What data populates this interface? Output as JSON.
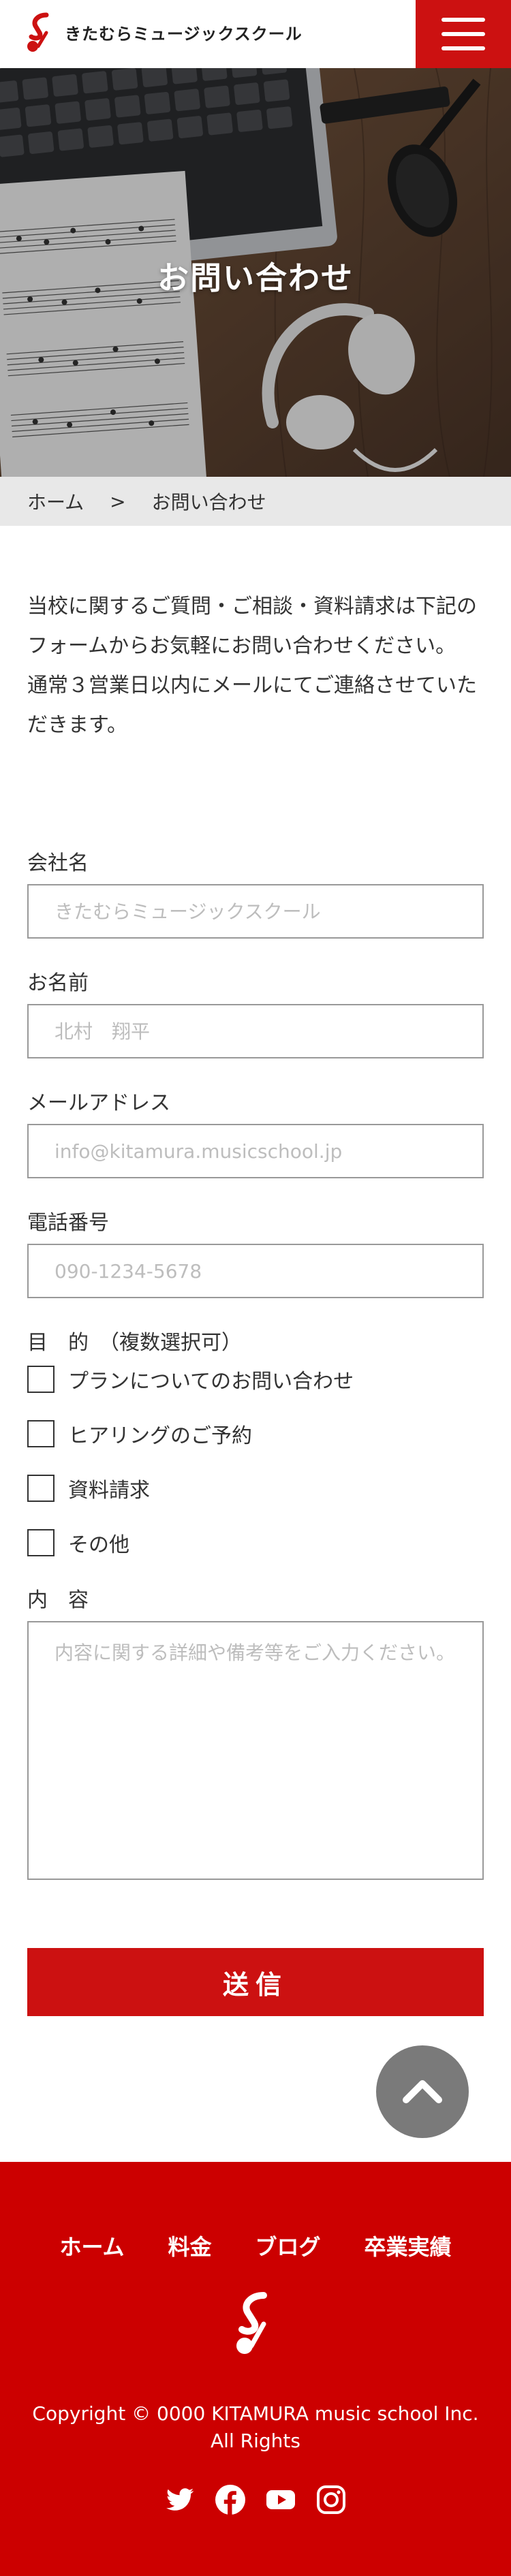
{
  "header": {
    "logo_text": "きたむらミュージックスクール",
    "menu_icon": "hamburger-menu-icon"
  },
  "hero": {
    "title": "お問い合わせ"
  },
  "breadcrumb": {
    "home": "ホーム",
    "separator": ">",
    "current": "お問い合わせ"
  },
  "intro": {
    "line1": "当校に関するご質問・ご相談・資料請求は下記のフォームからお気軽にお問い合わせください。",
    "line2": "通常３営業日以内にメールにてご連絡させていただきます。"
  },
  "form": {
    "company_label": "会社名",
    "company_placeholder": "きたむらミュージックスクール",
    "name_label": "お名前",
    "name_placeholder": "北村　翔平",
    "email_label": "メールアドレス",
    "email_placeholder": "info@kitamura.musicschool.jp",
    "phone_label": "電話番号",
    "phone_placeholder": "090-1234-5678",
    "purpose_label": "目　的　（複数選択可）",
    "purposes": [
      "プランについてのお問い合わせ",
      "ヒアリングのご予約",
      "資料請求",
      "その他"
    ],
    "content_label": "内　容",
    "content_placeholder": "内容に関する詳細や備考等をご入力ください。",
    "submit_label": "送信"
  },
  "pagetop_icon": "chevron-up-icon",
  "footer": {
    "nav": [
      "ホーム",
      "料金",
      "ブログ",
      "卒業実績"
    ],
    "copyright_line1": "Copyright © 0000 KITAMURA music school Inc.",
    "copyright_line2": "All Rights",
    "social_icons": [
      "twitter-icon",
      "facebook-icon",
      "youtube-icon",
      "instagram-icon"
    ]
  },
  "colors": {
    "brand_red": "#cc1111",
    "footer_red": "#cc0000",
    "pagetop_gray": "#7a7a7a",
    "breadcrumb_bg": "#e8e8e8"
  }
}
